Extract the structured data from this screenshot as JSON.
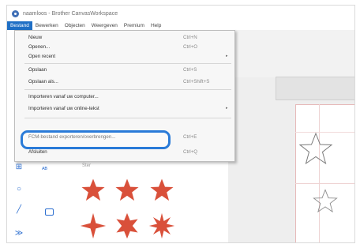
{
  "window": {
    "title": "naamloos - Brother CanvasWorkspace"
  },
  "menubar": {
    "items": [
      "Bestand",
      "Bewerken",
      "Objecten",
      "Weergeven",
      "Premium",
      "Help"
    ]
  },
  "file_menu": {
    "items": [
      {
        "label": "Nieuw",
        "shortcut": "Ctrl+N"
      },
      {
        "label": "Openen...",
        "shortcut": "Ctrl+O"
      },
      {
        "label": "Open recent",
        "shortcut": "",
        "submenu": "▸"
      },
      {
        "label": "Opslaan",
        "shortcut": "Ctrl+S"
      },
      {
        "label": "Opslaan als...",
        "shortcut": "Ctrl+Shift+S"
      },
      {
        "label": "Importeren vanaf uw computer...",
        "shortcut": ""
      },
      {
        "label": "Importeren vanaf uw online-tekst",
        "shortcut": "",
        "submenu": "▸"
      },
      {
        "label": "FCM-bestand exporteren/overbrengen...",
        "shortcut": "Ctrl+E"
      },
      {
        "label": "Afsluiten",
        "shortcut": "Ctrl+Q"
      }
    ]
  },
  "panel": {
    "label": "Ster"
  },
  "colors": {
    "accent": "#2a7bd8",
    "star": "#d9503a",
    "menu_active": "#1f6fc5"
  }
}
